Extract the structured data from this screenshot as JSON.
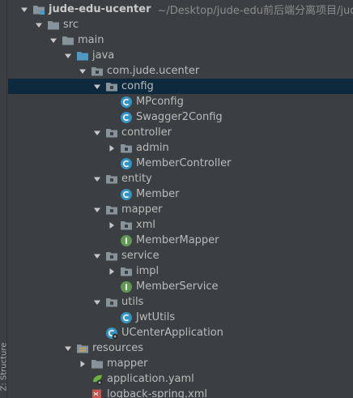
{
  "sidebar": {
    "structure_label": "Z: Structure"
  },
  "tree": {
    "project": {
      "name": "jude-edu-ucenter",
      "path": "~/Desktop/jude-edu前后端分离项目/jude-edu"
    },
    "src": "src",
    "main": "main",
    "java": "java",
    "package": "com.jude.ucenter",
    "config": "config",
    "mpconfig": "MPconfig",
    "swagger2config": "Swagger2Config",
    "controller": "controller",
    "admin": "admin",
    "membercontroller": "MemberController",
    "entity": "entity",
    "member": "Member",
    "mapper": "mapper",
    "xml": "xml",
    "membermapper": "MemberMapper",
    "service": "service",
    "impl": "impl",
    "memberservice": "MemberService",
    "utils": "utils",
    "jwtutils": "JwtUtils",
    "ucenterapp": "UCenterApplication",
    "resources": "resources",
    "res_mapper": "mapper",
    "application_yaml": "application.yaml",
    "logback": "logback-spring.xml"
  },
  "colors": {
    "background": "#3c3f41",
    "selection": "#0d293e",
    "folder": "#87939a",
    "source_folder": "#4e9ac6",
    "class_icon": "#3592c4",
    "interface_icon": "#629755",
    "text": "#bbbbbb"
  }
}
